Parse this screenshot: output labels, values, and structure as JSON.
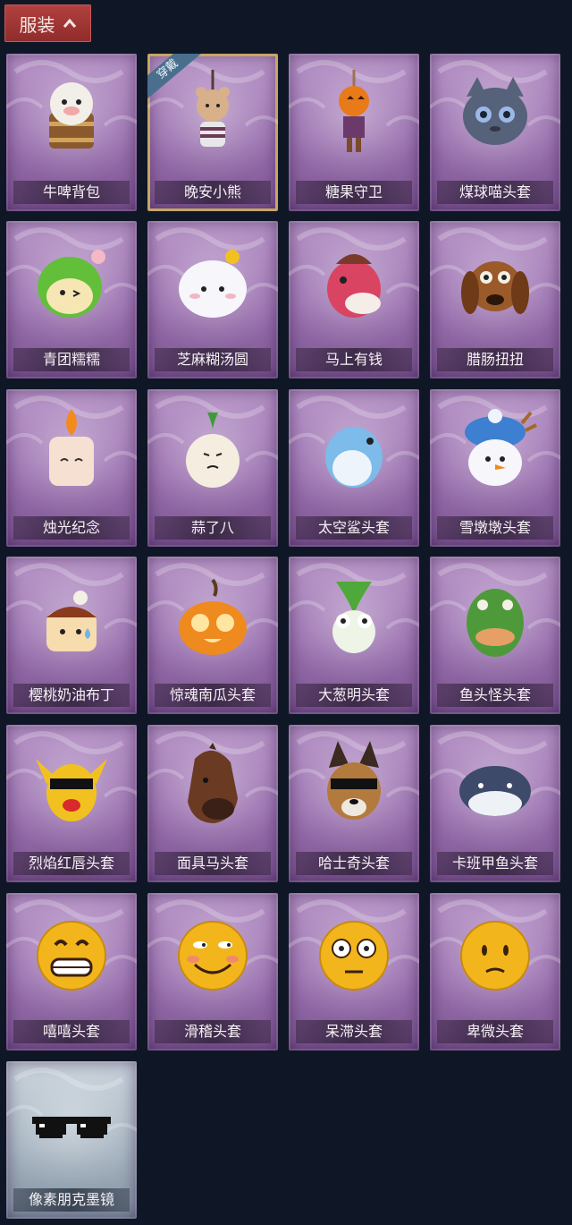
{
  "header": {
    "title": "服装"
  },
  "status": {
    "equipped_badge": "穿戴"
  },
  "items": [
    {
      "label": "牛啤背包",
      "icon": "cow-beer-backpack-icon"
    },
    {
      "label": "晚安小熊",
      "icon": "bear-keychain-icon",
      "equipped": true
    },
    {
      "label": "糖果守卫",
      "icon": "pumpkin-doll-icon"
    },
    {
      "label": "煤球喵头套",
      "icon": "cat-head-icon"
    },
    {
      "label": "青团糯糯",
      "icon": "green-dumpling-icon"
    },
    {
      "label": "芝麻糊汤圆",
      "icon": "white-dumpling-icon"
    },
    {
      "label": "马上有钱",
      "icon": "red-horse-icon"
    },
    {
      "label": "腊肠扭扭",
      "icon": "dachshund-icon"
    },
    {
      "label": "烛光纪念",
      "icon": "candle-icon"
    },
    {
      "label": "蒜了八",
      "icon": "garlic-icon"
    },
    {
      "label": "太空鲨头套",
      "icon": "shark-head-icon"
    },
    {
      "label": "雪墩墩头套",
      "icon": "snowman-head-icon"
    },
    {
      "label": "樱桃奶油布丁",
      "icon": "pudding-icon"
    },
    {
      "label": "惊魂南瓜头套",
      "icon": "jack-o-lantern-icon"
    },
    {
      "label": "大葱明头套",
      "icon": "scallion-head-icon"
    },
    {
      "label": "鱼头怪头套",
      "icon": "fish-head-icon"
    },
    {
      "label": "烈焰红唇头套",
      "icon": "yellow-mask-icon"
    },
    {
      "label": "面具马头套",
      "icon": "horse-mask-icon"
    },
    {
      "label": "哈士奇头套",
      "icon": "husky-head-icon"
    },
    {
      "label": "卡班甲鱼头套",
      "icon": "whale-head-icon"
    },
    {
      "label": "嘻嘻头套",
      "icon": "grin-emoji-icon"
    },
    {
      "label": "滑稽头套",
      "icon": "smirk-emoji-icon"
    },
    {
      "label": "呆滞头套",
      "icon": "dazed-emoji-icon"
    },
    {
      "label": "卑微头套",
      "icon": "humble-emoji-icon"
    },
    {
      "label": "像素朋克墨镜",
      "icon": "pixel-sunglasses-icon",
      "variant": "blue"
    }
  ]
}
